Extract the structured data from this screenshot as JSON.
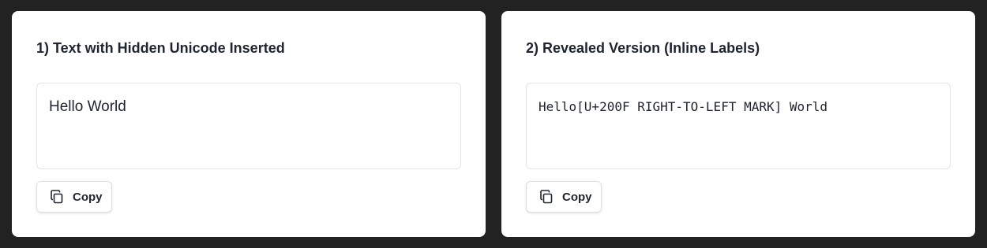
{
  "panels": [
    {
      "title": "1) Text with Hidden Unicode Inserted",
      "text": "Hello World",
      "copy_label": "Copy",
      "copy_icon": "copy-icon"
    },
    {
      "title": "2) Revealed Version (Inline Labels)",
      "text": "Hello[U+200F RIGHT-TO-LEFT MARK] World",
      "copy_label": "Copy",
      "copy_icon": "copy-icon"
    }
  ],
  "colors": {
    "background": "#222222",
    "panel": "#ffffff",
    "text": "#1f2430",
    "border": "#e2e4e8"
  }
}
